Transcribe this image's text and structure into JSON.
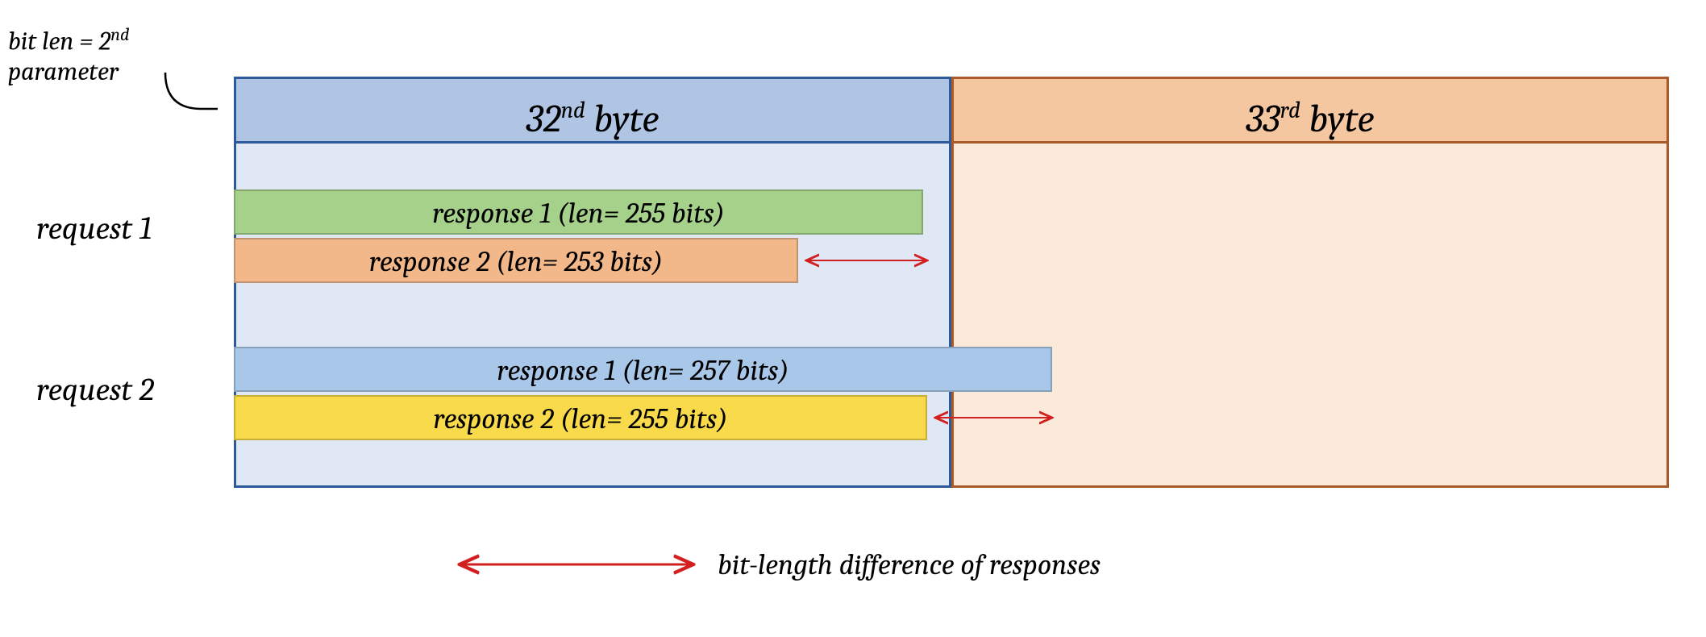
{
  "bit_len_label_html": "bit len = 2<span class='ord'>nd</span> parameter",
  "byte32_header_html": "32<span class='ord'>nd</span> byte",
  "byte33_header_html": "33<span class='ord'>rd</span> byte",
  "request1_label": "request 1",
  "request2_label": "request 2",
  "r1_resp1": "response 1 (len= 255 bits)",
  "r1_resp2": "response 2  (len= 253 bits)",
  "r2_resp1": "response 1 (len= 257 bits)",
  "r2_resp2": "response 2 (len= 255 bits)",
  "note_text": "bit-length difference of responses",
  "colors": {
    "byte32_border": "#2c5a9a",
    "byte32_header": "#b0c4e4",
    "byte32_body": "#e1e8f5",
    "byte33_border": "#a85a2a",
    "byte33_header": "#f4c7a1",
    "byte33_body": "#fbe9d9",
    "bar_green": "#a6d18b",
    "bar_orange": "#f2b88a",
    "bar_blue": "#a9c7e8",
    "bar_yellow": "#f8da4a",
    "arrow_red": "#d21f1f"
  },
  "chart_data": {
    "type": "table",
    "title": "Two queries to a scalar-multiplication oracle; each response's bit length relative to the 32nd/33rd byte boundary (the bit_len query parameter)",
    "byte_boundary_bits": {
      "byte32_end": 256,
      "byte33_end": 264
    },
    "series": [
      {
        "name": "request 1",
        "responses": [
          {
            "name": "response 1",
            "len_bits": 255,
            "color": "green"
          },
          {
            "name": "response 2",
            "len_bits": 253,
            "color": "orange"
          }
        ],
        "diff_bits": 2,
        "crosses_byte_boundary": false
      },
      {
        "name": "request 2",
        "responses": [
          {
            "name": "response 1",
            "len_bits": 257,
            "color": "blue"
          },
          {
            "name": "response 2",
            "len_bits": 255,
            "color": "yellow"
          }
        ],
        "diff_bits": 2,
        "crosses_byte_boundary": true
      }
    ],
    "annotation": "double-headed red arrows mark the bit-length difference between the two responses of each request"
  }
}
